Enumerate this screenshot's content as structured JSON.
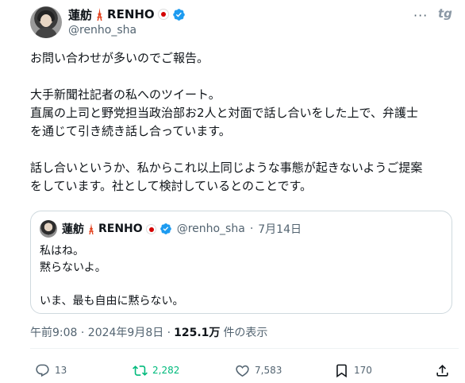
{
  "author": {
    "name": "蓮舫",
    "name_suffix": "RENHO",
    "handle": "@renho_sha"
  },
  "header_icons": [
    "tokyo-tower-icon",
    "japan-flag-icon",
    "verified-icon",
    "more-icon",
    "grok-icon"
  ],
  "tweet": {
    "lines": [
      "お問い合わせが多いのでご報告。",
      "",
      "大手新聞社記者の私へのツイート。",
      "直属の上司と野党担当政治部お2人と対面で話し合いをした上で、弁護士",
      "を通じて引き続き話し合っています。",
      "",
      "話し合いというか、私からこれ以上同じような事態が起きないようご提案",
      "をしています。社として検討しているとのことです。"
    ]
  },
  "quote": {
    "name": "蓮舫",
    "name_suffix": "RENHO",
    "handle": "@renho_sha",
    "separator": "·",
    "date": "7月14日",
    "lines": [
      "私はね。",
      "黙らないよ。",
      "",
      "いま、最も自由に黙らない。"
    ]
  },
  "meta": {
    "timestamp": "午前9:08 · 2024年9月8日 ·",
    "views_count": "125.1万",
    "views_label": "件の表示"
  },
  "actions": {
    "replies": "13",
    "retweets": "2,282",
    "likes": "7,583",
    "bookmarks": "170"
  },
  "colors": {
    "text": "#0f1419",
    "secondary": "#536471",
    "verified": "#1d9bf0",
    "retweet_active": "#00ba7c",
    "border": "#cfd9de",
    "flag_red": "#d40000"
  }
}
